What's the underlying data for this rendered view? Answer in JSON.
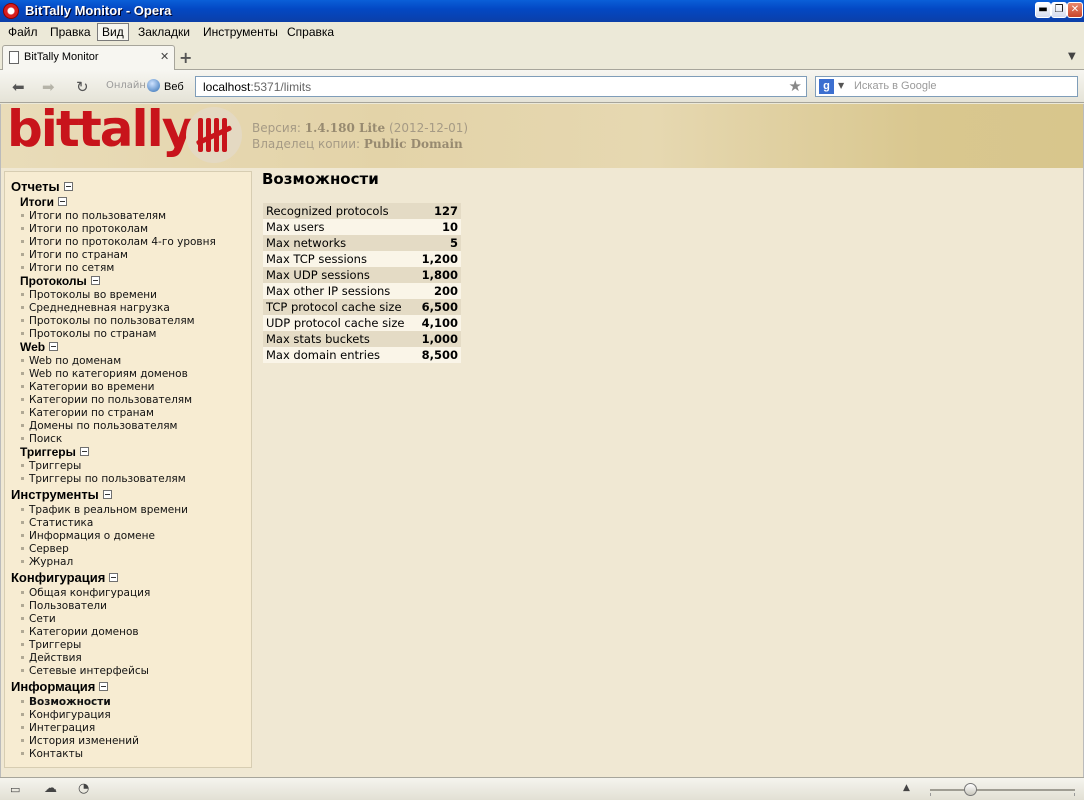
{
  "window": {
    "title": "BitTally Monitor - Opera",
    "minimize_glyph": "▬",
    "maximize_glyph": "❐",
    "close_glyph": "✕"
  },
  "menu": {
    "items": [
      "Файл",
      "Правка",
      "Вид",
      "Закладки",
      "Инструменты",
      "Справка"
    ]
  },
  "tabs": {
    "active_label": "BitTally Monitor",
    "close_glyph": "✕",
    "new_tab_glyph": "+",
    "menu_glyph": "▼"
  },
  "toolbar": {
    "back_glyph": "⬅",
    "forward_glyph": "➡",
    "reload_glyph": "↻",
    "feature_label": "Онлайн",
    "web_label": "Веб",
    "url_host": "localhost",
    "url_path": ":5371/limits",
    "bookmark_glyph": "★",
    "search_engine_letter": "g",
    "search_arrow": "▼",
    "search_placeholder": "Искать в Google"
  },
  "banner": {
    "logo_text": "bittally",
    "version_prefix": "Версия:",
    "version_number": "1.4.180 Lite",
    "version_date": "(2012-12-01)",
    "owner_prefix": "Владелец копии:",
    "owner_name": "Public Domain"
  },
  "sidebar": {
    "reports": {
      "label": "Отчеты",
      "totals": {
        "label": "Итоги",
        "items": [
          "Итоги по пользователям",
          "Итоги по протоколам",
          "Итоги по протоколам 4-го уровня",
          "Итоги по странам",
          "Итоги по сетям"
        ]
      },
      "protocols": {
        "label": "Протоколы",
        "items": [
          "Протоколы во времени",
          "Среднедневная нагрузка",
          "Протоколы по пользователям",
          "Протоколы по странам"
        ]
      },
      "web": {
        "label": "Web",
        "items": [
          "Web по доменам",
          "Web по категориям доменов",
          "Категории во времени",
          "Категории по пользователям",
          "Категории по странам",
          "Домены по пользователям",
          "Поиск"
        ]
      },
      "triggers": {
        "label": "Триггеры",
        "items": [
          "Триггеры",
          "Триггеры по пользователям"
        ]
      }
    },
    "tools": {
      "label": "Инструменты",
      "items": [
        "Трафик в реальном времени",
        "Статистика",
        "Информация о домене",
        "Сервер",
        "Журнал"
      ]
    },
    "config": {
      "label": "Конфигурация",
      "items": [
        "Общая конфигурация",
        "Пользователи",
        "Сети",
        "Категории доменов",
        "Триггеры",
        "Действия",
        "Сетевые интерфейсы"
      ]
    },
    "info": {
      "label": "Информация",
      "items": [
        "Возможности",
        "Конфигурация",
        "Интеграция",
        "История изменений",
        "Контакты"
      ]
    }
  },
  "main": {
    "title": "Возможности",
    "rows": [
      {
        "name": "Recognized protocols",
        "value": "127"
      },
      {
        "name": "Max users",
        "value": "10"
      },
      {
        "name": "Max networks",
        "value": "5"
      },
      {
        "name": "Max TCP sessions",
        "value": "1,200"
      },
      {
        "name": "Max UDP sessions",
        "value": "1,800"
      },
      {
        "name": "Max other IP sessions",
        "value": "200"
      },
      {
        "name": "TCP protocol cache size",
        "value": "6,500"
      },
      {
        "name": "UDP protocol cache size",
        "value": "4,100"
      },
      {
        "name": "Max stats buckets",
        "value": "1,000"
      },
      {
        "name": "Max domain entries",
        "value": "8,500"
      }
    ]
  },
  "statusbar": {
    "panel_glyph": "▭",
    "cloud_glyph": "☁",
    "speed_glyph": "◔",
    "zoom_up_glyph": "▲"
  }
}
